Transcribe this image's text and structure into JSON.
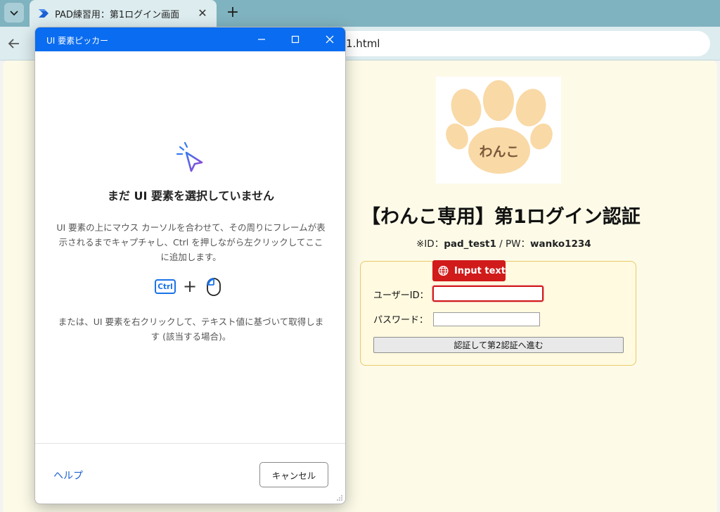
{
  "browser": {
    "tab_title": "PAD練習用：第1ログイン画面",
    "tab_close": "✕",
    "new_tab": "+",
    "url_visible": "1.html"
  },
  "page": {
    "logo_text": "わんこ",
    "title": "【わんこ専用】第1ログイン認証",
    "hint_prefix": "※ID：",
    "hint_id": "pad_test1",
    "hint_mid": " / PW：",
    "hint_pw": "wanko1234",
    "user_label": "ユーザーID：",
    "pass_label": "パスワード：",
    "user_value": "",
    "pass_value": "",
    "submit_label": "認証して第2認証へ進む",
    "badge_label": "Input text"
  },
  "dialog": {
    "title": "UI 要素ピッカー",
    "heading": "まだ UI 要素を選択していません",
    "instruction": "UI 要素の上にマウス カーソルを合わせて、その周りにフレームが表示されるまでキャプチャし、Ctrl を押しながら左クリックしてここに追加します。",
    "ctrl_key": "Ctrl",
    "plus": "+",
    "alternative": "または、UI 要素を右クリックして、テキスト値に基づいて取得します (該当する場合)。",
    "help_label": "ヘルプ",
    "cancel_label": "キャンセル"
  },
  "colors": {
    "tabbar": "#7fb3bf",
    "dialog_titlebar": "#0a6cf0",
    "highlight_red": "#d11a1a",
    "paw_orange": "#f9d9a6",
    "link_blue": "#1a5fd0"
  },
  "icons": {
    "tab_list": "chevron-down-icon",
    "favicon": "power-automate-icon",
    "back": "arrow-left-icon",
    "minimize": "minimize-icon",
    "maximize": "maximize-icon",
    "close": "close-icon",
    "picker": "cursor-click-icon",
    "mouse": "mouse-icon",
    "globe": "globe-icon"
  }
}
